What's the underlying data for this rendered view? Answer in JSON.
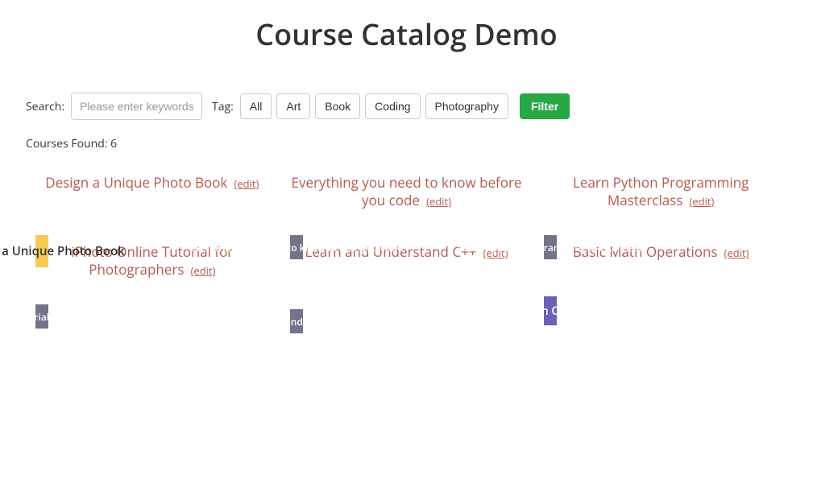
{
  "page_title": "Course Catalog Demo",
  "search": {
    "label": "Search:",
    "placeholder": "Please enter keywords"
  },
  "tag_label": "Tag:",
  "tags": [
    "All",
    "Art",
    "Book",
    "Coding",
    "Photography"
  ],
  "filter_button": "Filter",
  "courses_found_label": "Courses Found: ",
  "courses_found_count": "6",
  "edit_label": "(edit)",
  "colors": {
    "link": "#b85a50",
    "filter_bg": "#28a745"
  },
  "courses": [
    {
      "title": "Design a Unique Photo Book",
      "overlay_style": "yellow"
    },
    {
      "title": "Everything you need to know before you code",
      "overlay_style": "dark"
    },
    {
      "title": "Learn Python Programming Masterclass",
      "overlay_style": "dark"
    },
    {
      "title": "iPhoto Online Tutorial for Photographers",
      "overlay_style": "dark"
    },
    {
      "title": "Learn and Understand C++",
      "overlay_style": "dark"
    },
    {
      "title": "Basic Math Operations",
      "overlay_style": "purple"
    }
  ]
}
